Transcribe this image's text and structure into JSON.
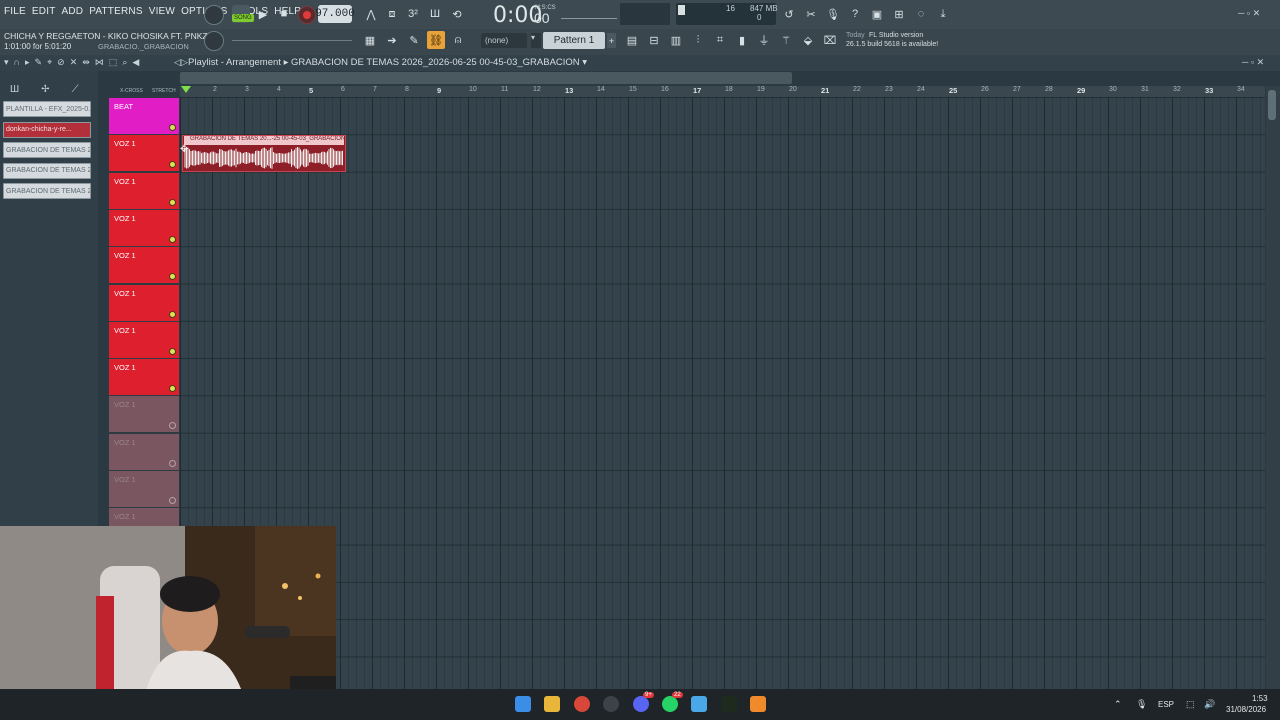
{
  "menu": [
    "FILE",
    "EDIT",
    "ADD",
    "PATTERNS",
    "VIEW",
    "OPTIONS",
    "TOOLS",
    "HELP"
  ],
  "transport": {
    "song_label": "SONG",
    "tempo": "97.000",
    "time_main": "0:00",
    "time_cs": "00",
    "time_unit": "M:S:CS",
    "cpu_voices": "16",
    "memory": "847 MB",
    "cpu_zero": "0"
  },
  "project": {
    "title": "CHICHA Y REGGAETON - KIKO CHOSIKA FT. PNKZ.flp",
    "time": "1:01:00 for 5:01:20",
    "file": "GRABACIO._GRABACION"
  },
  "toolbar2": {
    "pattern_none": "(none)",
    "pattern": "Pattern 1",
    "news_when": "Today",
    "news_title": "FL Studio version",
    "news_body": "26.1.5 build 5618 is available!"
  },
  "playlist": {
    "title": "Playlist - Arrangement",
    "arrangement": "GRABACION DE TEMAS 2026_2026-06-25 00-45-03_GRABACION",
    "xcross": "X-CROSS",
    "stretch": "STRETCH",
    "ruler": [
      "2",
      "3",
      "4",
      "5",
      "6",
      "7",
      "8",
      "9",
      "10",
      "11",
      "12",
      "13",
      "14",
      "15",
      "16",
      "17",
      "18",
      "19",
      "20",
      "21",
      "22",
      "23",
      "24",
      "25",
      "26",
      "27",
      "28",
      "29",
      "30",
      "31",
      "32",
      "33",
      "34"
    ]
  },
  "browser": {
    "items": [
      {
        "label": "PLANTILLA - EFX_2025-0...",
        "style": "gray"
      },
      {
        "label": "donkan-chicha-y-re...",
        "style": "red"
      },
      {
        "label": "GRABACION DE TEMAS 202...",
        "style": "gray"
      },
      {
        "label": "GRABACION DE TEMAS 202...",
        "style": "gray"
      },
      {
        "label": "GRABACION DE TEMAS 202...",
        "style": "gray"
      }
    ]
  },
  "tracks": [
    {
      "name": "BEAT",
      "style": "beat"
    },
    {
      "name": "VOZ 1",
      "style": "voz"
    },
    {
      "name": "VOZ 1",
      "style": "voz"
    },
    {
      "name": "VOZ 1",
      "style": "voz"
    },
    {
      "name": "VOZ 1",
      "style": "voz"
    },
    {
      "name": "VOZ 1",
      "style": "voz"
    },
    {
      "name": "VOZ 1",
      "style": "voz"
    },
    {
      "name": "VOZ 1",
      "style": "voz"
    },
    {
      "name": "VOZ 1",
      "style": "dim"
    },
    {
      "name": "VOZ 1",
      "style": "dim"
    },
    {
      "name": "VOZ 1",
      "style": "dim"
    },
    {
      "name": "VOZ 1",
      "style": "dim"
    }
  ],
  "clip": {
    "title": "GRABACION DE TEMAS 20...-25 00-45-03_GRABACION"
  },
  "taskbar": {
    "lang": "ESP",
    "time": "1:53",
    "date": "31/08/2026",
    "badge_discord": "9+",
    "badge_whatsapp": "22"
  },
  "colors": {
    "beat_track": "#e11ec6",
    "voz_track": "#de1f2e",
    "clip": "#8e1f28",
    "song_active": "#7ecb2f",
    "record": "#e03b3b"
  },
  "icons": [
    "record-icon",
    "play-icon",
    "stop-icon",
    "metronome-icon",
    "mixer-icon",
    "piano-roll-icon",
    "channel-rack-icon",
    "browser-icon",
    "plugin-icon",
    "undo-icon",
    "cut-icon",
    "mic-icon",
    "help-icon",
    "save-icon",
    "chat-icon",
    "download-icon",
    "magnet-icon",
    "pencil-icon",
    "paint-icon",
    "delete-icon",
    "mute-icon",
    "slice-icon",
    "select-icon",
    "zoom-icon",
    "speaker-icon"
  ]
}
